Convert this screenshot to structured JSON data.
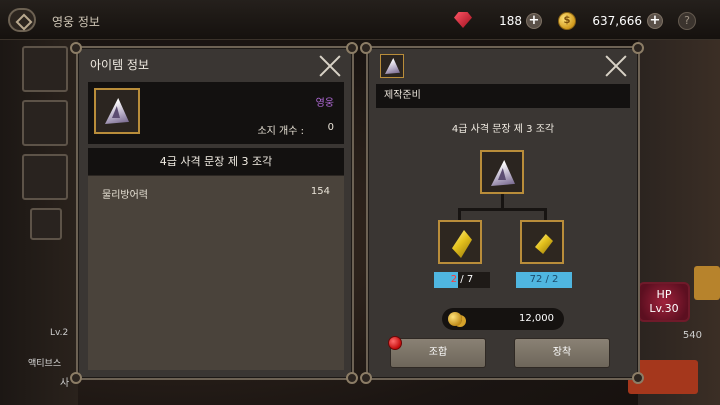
{
  "topbar": {
    "title": "영웅 정보",
    "gems": "188",
    "gold": "637,666",
    "add_label": "+",
    "help_label": "?",
    "coin_symbol": "$"
  },
  "background": {
    "hp_label": "HP",
    "hp_level": "Lv.30",
    "right_value": "540",
    "skill_label": "액티브스",
    "skill_level": "Lv.2",
    "bottom_left_label": "사"
  },
  "item_info": {
    "title": "아이템 정보",
    "grade": "영웅",
    "owned_label": "소지 개수 :",
    "owned_value": "0",
    "item_name": "4급 사격 문장 제 3 조각",
    "stats": [
      {
        "name": "물리방어력",
        "value": "154"
      }
    ]
  },
  "crafting": {
    "section_label": "제작준비",
    "target_name": "4급 사격 문장 제 3 조각",
    "materials": [
      {
        "have": "2",
        "need": "7",
        "sep": " / ",
        "status": "short"
      },
      {
        "have": "72",
        "need": "2",
        "sep": " / ",
        "status": "ok"
      }
    ],
    "cost": "12,000",
    "combine_label": "조합",
    "equip_label": "장착"
  },
  "colors": {
    "grade_hero": "#b06ad6",
    "shortage": "#ff3b3b",
    "count_bar": "#4fb6e0",
    "frame_gold": "#b98d3a"
  },
  "icons": {
    "item": "triangle-crest-fragment-icon",
    "material_1": "yellow-crystal-icon",
    "material_2": "yellow-crystal-shard-icon",
    "currency": "gold-coin-icon",
    "premium_currency": "red-gem-icon"
  }
}
